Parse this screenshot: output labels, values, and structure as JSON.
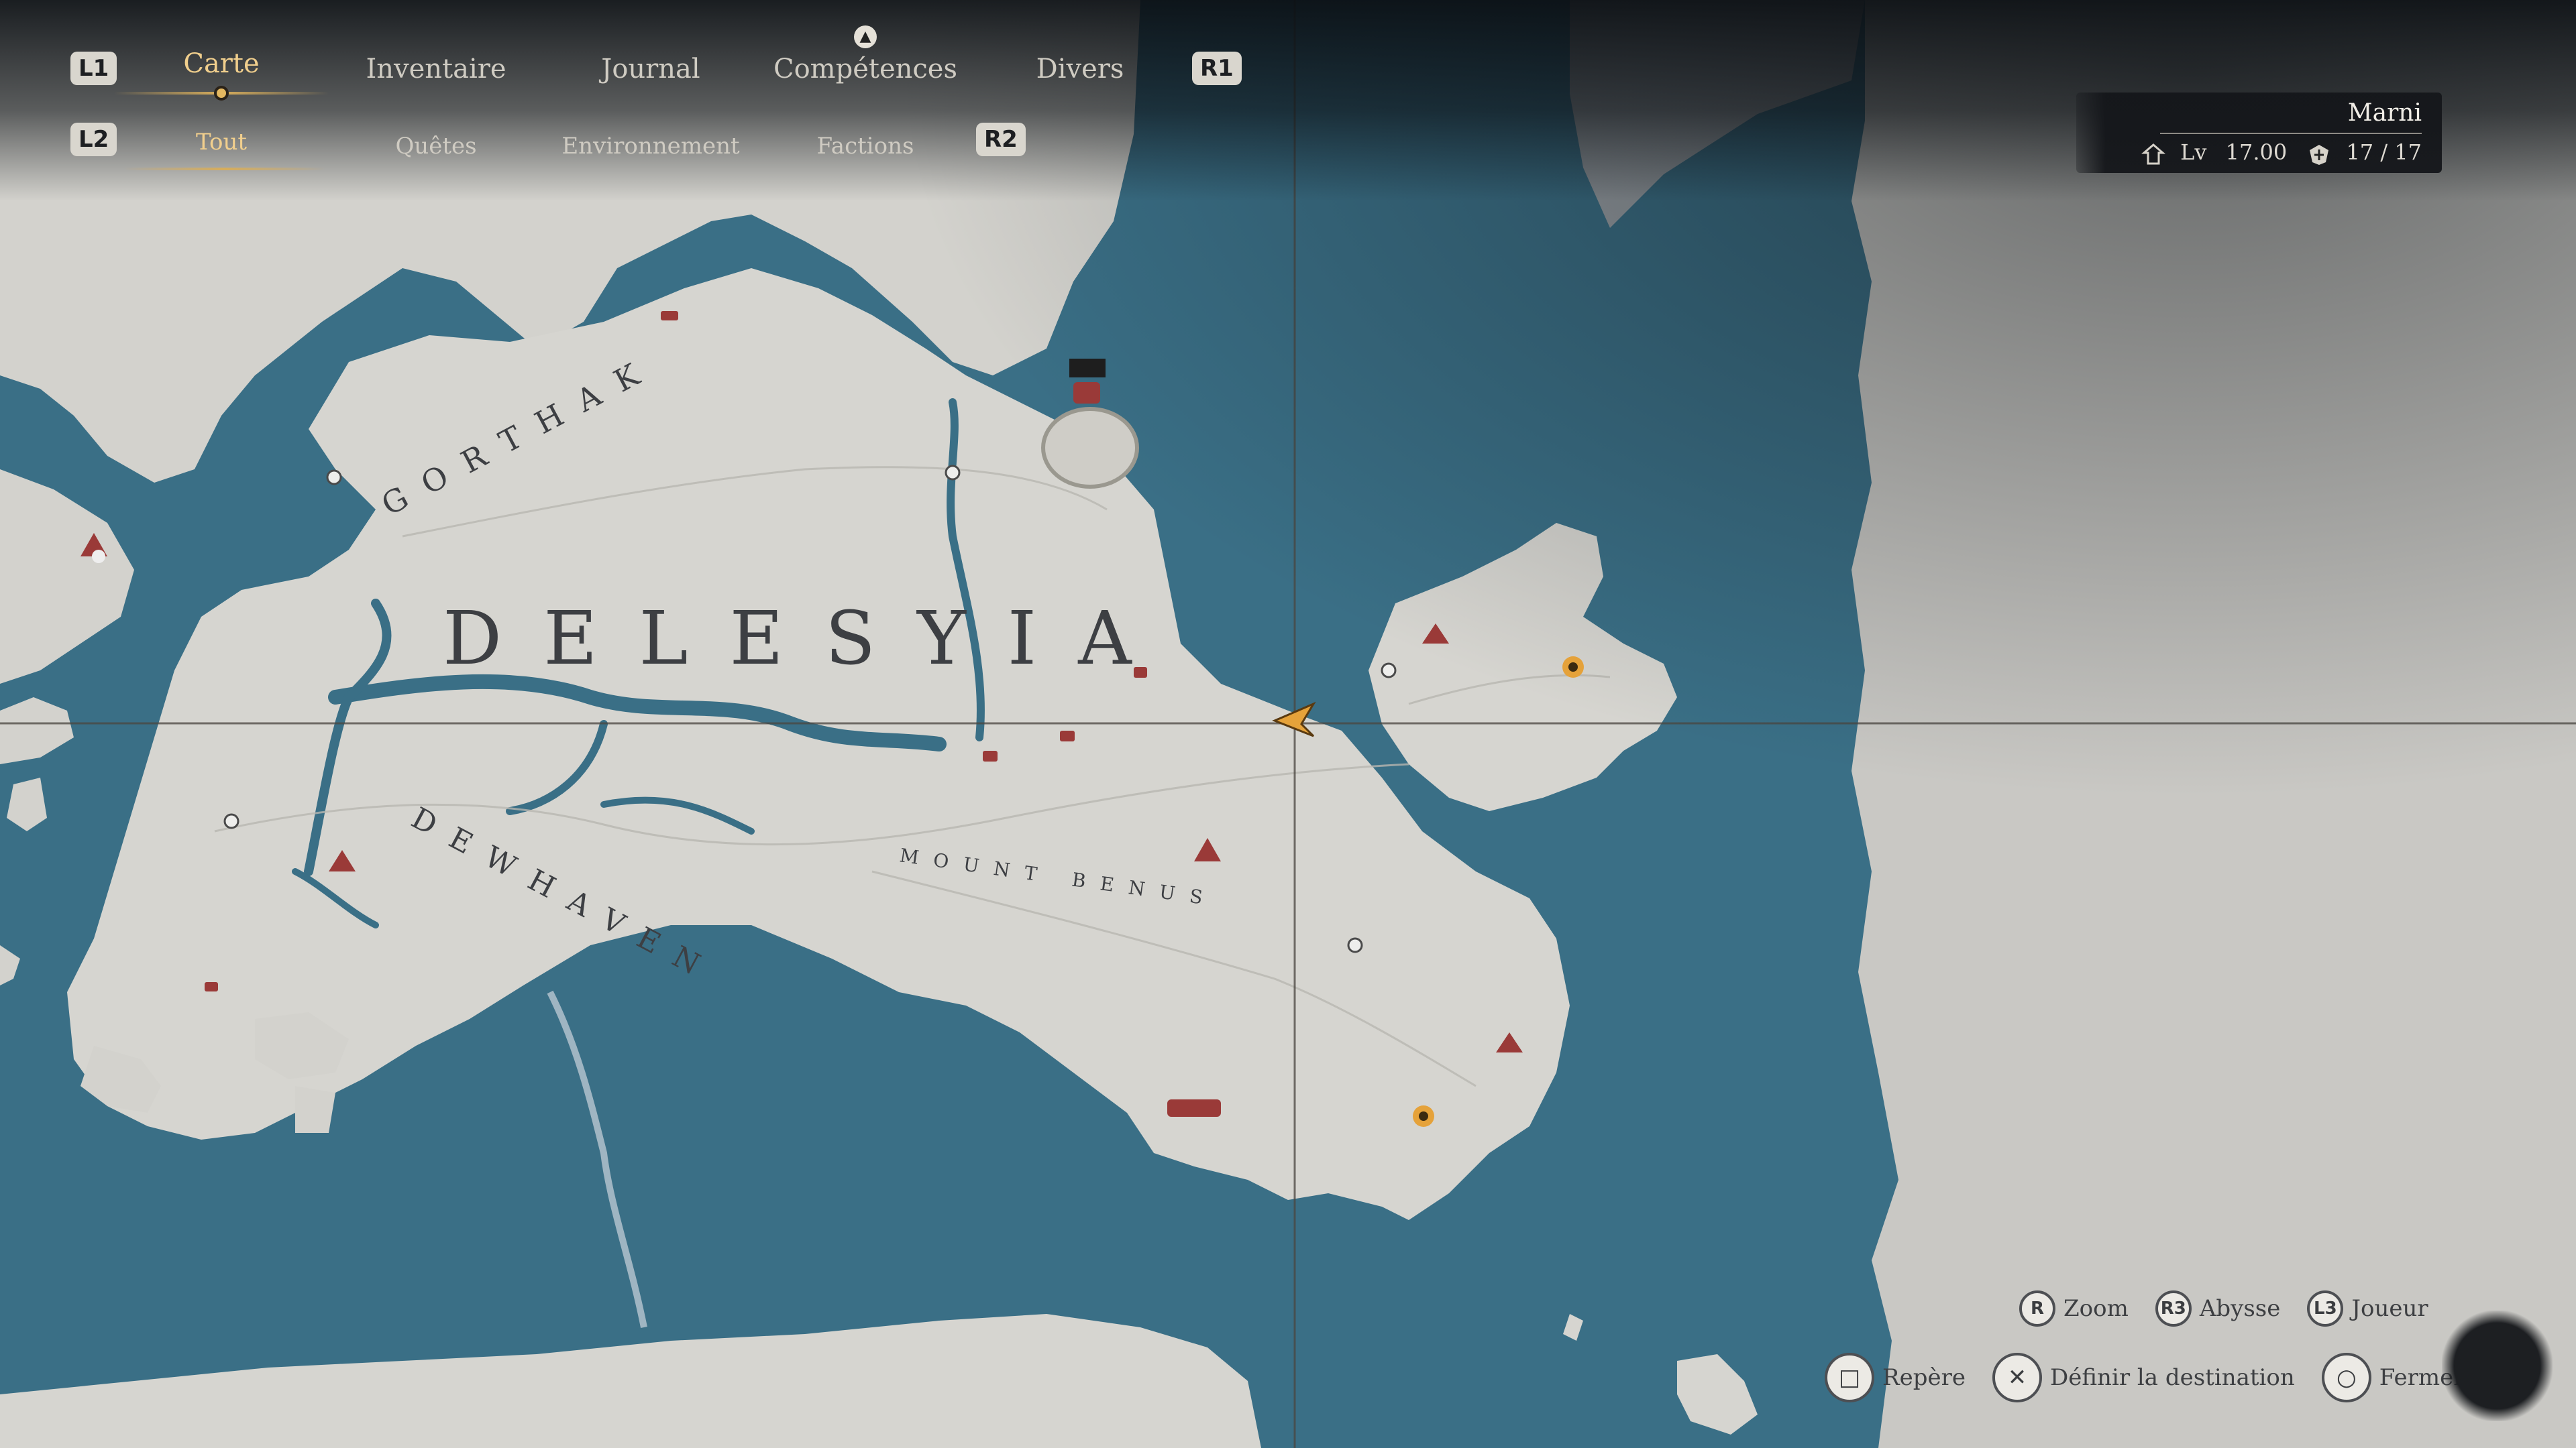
{
  "nav": {
    "l1": "L1",
    "r1": "R1",
    "l2": "L2",
    "r2": "R2",
    "tabs": [
      {
        "label": "Carte"
      },
      {
        "label": "Inventaire"
      },
      {
        "label": "Journal"
      },
      {
        "label": "Compétences"
      },
      {
        "label": "Divers"
      }
    ],
    "subtabs": [
      {
        "label": "Tout"
      },
      {
        "label": "Quêtes"
      },
      {
        "label": "Environnement"
      },
      {
        "label": "Factions"
      }
    ]
  },
  "player": {
    "name": "Marni",
    "level_label": "Lv",
    "level": "17.00",
    "health": "17 / 17"
  },
  "map": {
    "region_label": "DELESYIA",
    "area_labels": [
      "GORTHAK",
      "DEWHAVEN",
      "MOUNT BENUS"
    ]
  },
  "controls": [
    {
      "glyph": "R",
      "label": "Zoom"
    },
    {
      "glyph": "R3",
      "label": "Abysse"
    },
    {
      "glyph": "L3",
      "label": "Joueur"
    },
    {
      "glyph": "□",
      "label": "Repère"
    },
    {
      "glyph": "✕",
      "label": "Définir la destination"
    },
    {
      "glyph": "○",
      "label": "Fermer"
    }
  ],
  "colors": {
    "water": "#3a6f86",
    "land": "#d8d6d1",
    "active_tab": "#f1cf8d",
    "marker_red": "#9a3a38",
    "player_marker": "#e5a23a"
  }
}
